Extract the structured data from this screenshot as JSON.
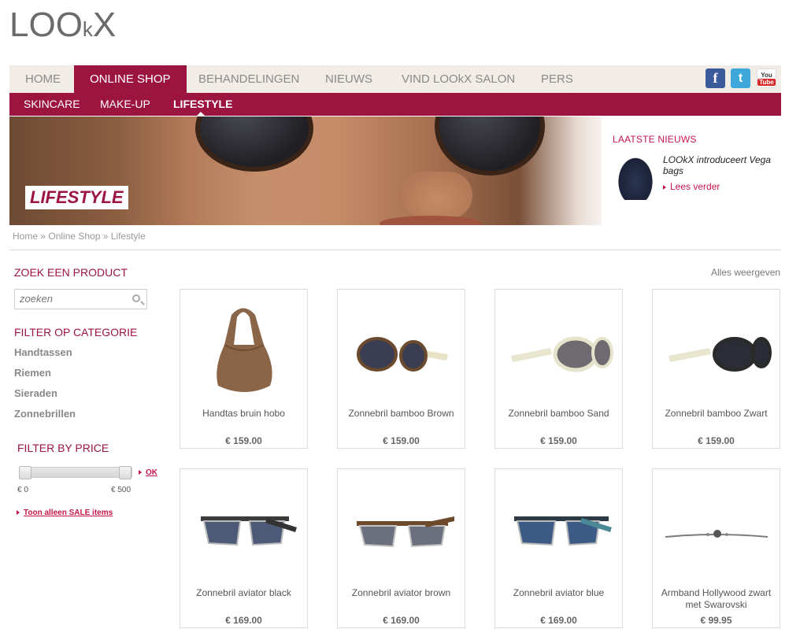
{
  "brand": {
    "logo_big": "LOO",
    "logo_small": "k",
    "logo_end": "X"
  },
  "topnav": {
    "items": [
      {
        "label": "HOME"
      },
      {
        "label": "ONLINE SHOP"
      },
      {
        "label": "BEHANDELINGEN"
      },
      {
        "label": "NIEUWS"
      },
      {
        "label": "VIND LOOkX SALON"
      },
      {
        "label": "PERS"
      }
    ],
    "active": "ONLINE SHOP",
    "social": {
      "facebook": "f",
      "twitter": "t",
      "youtube_top": "You",
      "youtube_bottom": "Tube"
    }
  },
  "subnav": {
    "items": [
      {
        "label": "SKINCARE"
      },
      {
        "label": "MAKE-UP"
      },
      {
        "label": "LIFESTYLE"
      }
    ],
    "active": "LIFESTYLE"
  },
  "banner": {
    "label": "LIFESTYLE"
  },
  "news": {
    "heading": "LAATSTE NIEUWS",
    "title": "LOOkX introduceert Vega bags",
    "more": "Lees verder"
  },
  "breadcrumb": {
    "home": "Home",
    "sep": " » ",
    "shop": "Online Shop",
    "current": "Lifestyle"
  },
  "sidebar": {
    "search_heading": "ZOEK EEN PRODUCT",
    "search_placeholder": "zoeken",
    "category_heading": "FILTER OP CATEGORIE",
    "categories": [
      "Handtassen",
      "Riemen",
      "Sieraden",
      "Zonnebrillen"
    ],
    "price_heading": "FILTER BY PRICE",
    "price_min": "€ 0",
    "price_max": "€ 500",
    "ok": "OK",
    "sale_link": "Toon alleen SALE items"
  },
  "show_all": "Alles weergeven",
  "products": [
    {
      "name": "Handtas bruin hobo",
      "price": "€ 159.00",
      "image": "handbag-brown"
    },
    {
      "name": "Zonnebril bamboo Brown",
      "price": "€ 159.00",
      "image": "sunglasses-bamboo-brown"
    },
    {
      "name": "Zonnebril bamboo Sand",
      "price": "€ 159.00",
      "image": "sunglasses-bamboo-sand"
    },
    {
      "name": "Zonnebril bamboo Zwart",
      "price": "€ 159.00",
      "image": "sunglasses-bamboo-black"
    },
    {
      "name": "Zonnebril aviator black",
      "price": "€ 169.00",
      "image": "sunglasses-aviator-black"
    },
    {
      "name": "Zonnebril aviator brown",
      "price": "€ 169.00",
      "image": "sunglasses-aviator-brown"
    },
    {
      "name": "Zonnebril aviator blue",
      "price": "€ 169.00",
      "image": "sunglasses-aviator-blue"
    },
    {
      "name": "Armband Hollywood zwart met Swarovski",
      "price": "€ 99.95",
      "image": "bracelet"
    }
  ],
  "colors": {
    "accent": "#9b1540",
    "link": "#c6154a",
    "nav_bg": "#f2ece6"
  }
}
